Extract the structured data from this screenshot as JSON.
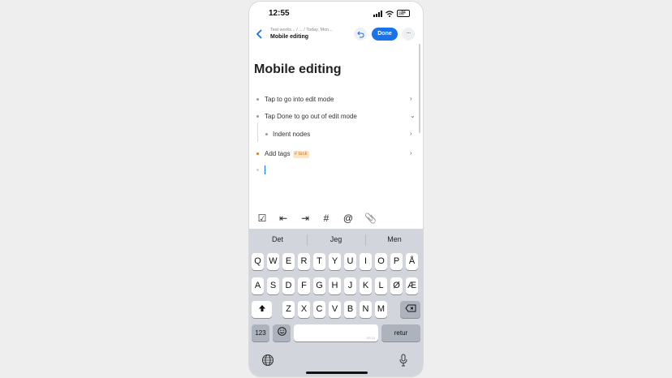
{
  "status": {
    "time": "12:55",
    "battery": "24"
  },
  "nav": {
    "breadcrumb": "Test works... / ... / Today, Mon...",
    "title": "Mobile editing",
    "done_label": "Done",
    "more_label": "···"
  },
  "document": {
    "title": "Mobile editing",
    "nodes": [
      {
        "text": "Tap to go into edit mode",
        "chevron": "›"
      },
      {
        "text": "Tap Done to go out of edit mode",
        "chevron": "⌄"
      },
      {
        "text": "Indent nodes",
        "chevron": "›"
      },
      {
        "text": "Add tags",
        "tag": "# task",
        "chevron": "›"
      }
    ]
  },
  "toolbar": {
    "checkbox": "☑",
    "outdent": "⇤",
    "indent": "⇥",
    "hash": "#",
    "mention": "@",
    "attach": "📎"
  },
  "keyboard": {
    "suggestions": [
      "Det",
      "Jeg",
      "Men"
    ],
    "row1": [
      "Q",
      "W",
      "E",
      "R",
      "T",
      "Y",
      "U",
      "I",
      "O",
      "P",
      "Å"
    ],
    "row2": [
      "A",
      "S",
      "D",
      "F",
      "G",
      "H",
      "J",
      "K",
      "L",
      "Ø",
      "Æ"
    ],
    "row3": [
      "Z",
      "X",
      "C",
      "V",
      "B",
      "N",
      "M"
    ],
    "numbers_label": "123",
    "space_hint": "SB DI",
    "return_label": "retur",
    "globe_icon": "⊕",
    "mic_icon": "🎙"
  },
  "colors": {
    "accent": "#1a73e8",
    "tag_bg": "#fde6cc",
    "tag_text": "#d97a1a"
  }
}
